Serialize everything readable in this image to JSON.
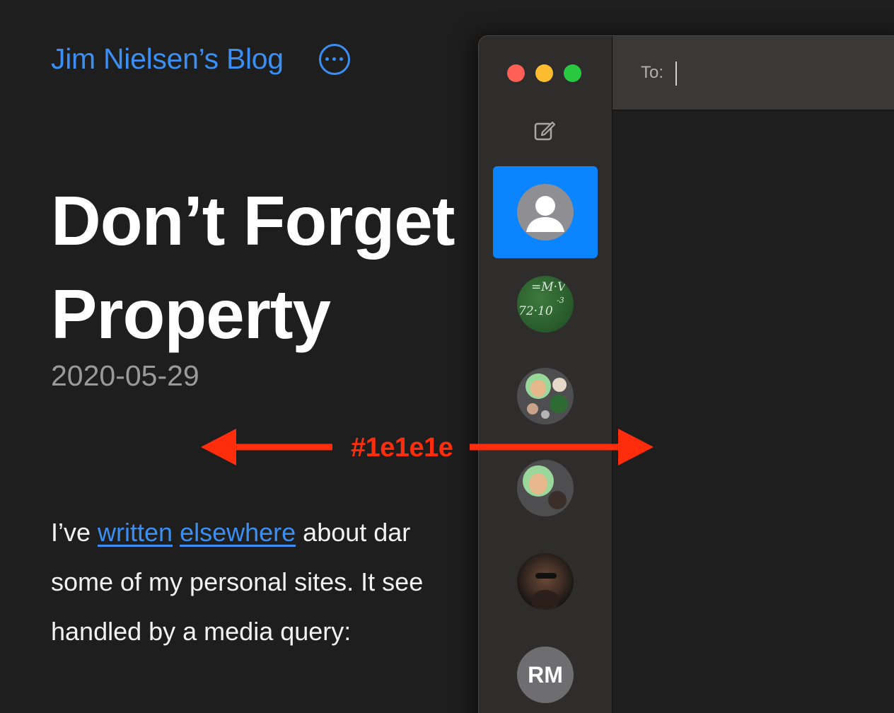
{
  "blog": {
    "site_title": "Jim Nielsen’s Blog",
    "menu_icon": "ellipsis-circle-icon",
    "post_title_line1": "Don’t Forget",
    "post_title_line2": "Property",
    "post_date": "2020-05-29",
    "body": {
      "line1_prefix": "I’ve ",
      "link1": "written",
      "link2": "elsewhere",
      "line1_suffix": " about dar",
      "line2": "some of my personal sites. It see",
      "line3": "handled by a media query:"
    }
  },
  "annotation": {
    "label": "#1e1e1e",
    "color": "#ff2d0c"
  },
  "messages_window": {
    "to_label": "To:",
    "compose_icon": "compose-icon",
    "conversations": [
      {
        "kind": "generic-contact",
        "selected": true
      },
      {
        "kind": "photo"
      },
      {
        "kind": "group"
      },
      {
        "kind": "group"
      },
      {
        "kind": "photo"
      },
      {
        "kind": "initials",
        "initials": "RM"
      }
    ],
    "avatar2_text": [
      "=M·V",
      "72·10",
      "-3"
    ]
  },
  "colors": {
    "page_background": "#1e1e1e",
    "link": "#3b8ff2",
    "selection": "#0a84ff"
  }
}
